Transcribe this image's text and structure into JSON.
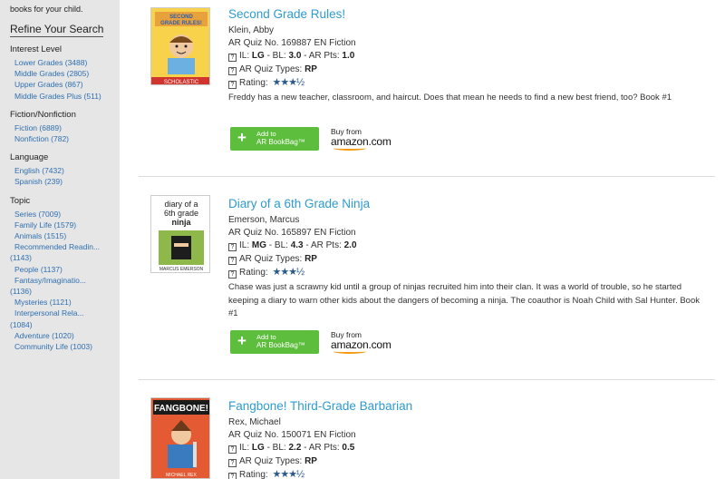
{
  "sidebar": {
    "intro": "books for your child.",
    "refine_title": "Refine Your Search",
    "sections": [
      {
        "title": "Interest Level",
        "items": [
          "Lower Grades (3488)",
          "Middle Grades (2805)",
          "Upper Grades (867)",
          "Middle Grades Plus (511)"
        ]
      },
      {
        "title": "Fiction/Nonfiction",
        "items": [
          "Fiction (6889)",
          "Nonfiction (782)"
        ]
      },
      {
        "title": "Language",
        "items": [
          "English (7432)",
          "Spanish (239)"
        ]
      },
      {
        "title": "Topic",
        "items": [
          "Series (7009)",
          "Family Life (1579)",
          "Animals (1515)",
          "Recommended Readin...",
          "(1143)",
          "People (1137)",
          "Fantasy/Imaginatio...",
          "(1136)",
          "Mysteries (1121)",
          "Interpersonal Rela...",
          "(1084)",
          "Adventure (1020)",
          "Community Life (1003)"
        ]
      }
    ]
  },
  "labels": {
    "il": "IL:",
    "bl": "- BL:",
    "pts": "- AR Pts:",
    "quiz_types": "AR Quiz Types:",
    "rating": "Rating:",
    "add_line1": "Add to",
    "add_line2": "AR BookBag™",
    "buy_from": "Buy from",
    "amazon": "amazon",
    "amazon_suffix": ".com"
  },
  "results": [
    {
      "title": "Second Grade Rules!",
      "author": "Klein, Abby",
      "quiz": "AR Quiz No. 169887 EN Fiction",
      "il": "LG",
      "bl": "3.0",
      "pts": "1.0",
      "quiz_types": "RP",
      "stars": "★★★½",
      "description": "Freddy has a new teacher, classroom, and haircut. Does that mean he needs to find a new best friend, too? Book #1",
      "cover_text": "SECOND GRADE RULES!",
      "cover_publisher": "SCHOLASTIC"
    },
    {
      "title": "Diary of a 6th Grade Ninja",
      "author": "Emerson, Marcus",
      "quiz": "AR Quiz No. 165897 EN Fiction",
      "il": "MG",
      "bl": "4.3",
      "pts": "2.0",
      "quiz_types": "RP",
      "stars": "★★★½",
      "description": "Chase was just a scrawny kid until a group of ninjas recruited him into their clan. It was a world of trouble, so he started keeping a diary to warn other kids about the dangers of becoming a ninja. The coauthor is Noah Child with Sal Hunter. Book #1",
      "cover_text": "diary of a 6th grade ninja",
      "cover_publisher": "MARCUS EMERSON"
    },
    {
      "title": "Fangbone! Third-Grade Barbarian",
      "author": "Rex, Michael",
      "quiz": "AR Quiz No. 150071 EN Fiction",
      "il": "LG",
      "bl": "2.2",
      "pts": "0.5",
      "quiz_types": "RP",
      "stars": "★★★½",
      "description": "",
      "cover_text": "FANGBONE!",
      "cover_publisher": "MICHAEL REX"
    }
  ]
}
